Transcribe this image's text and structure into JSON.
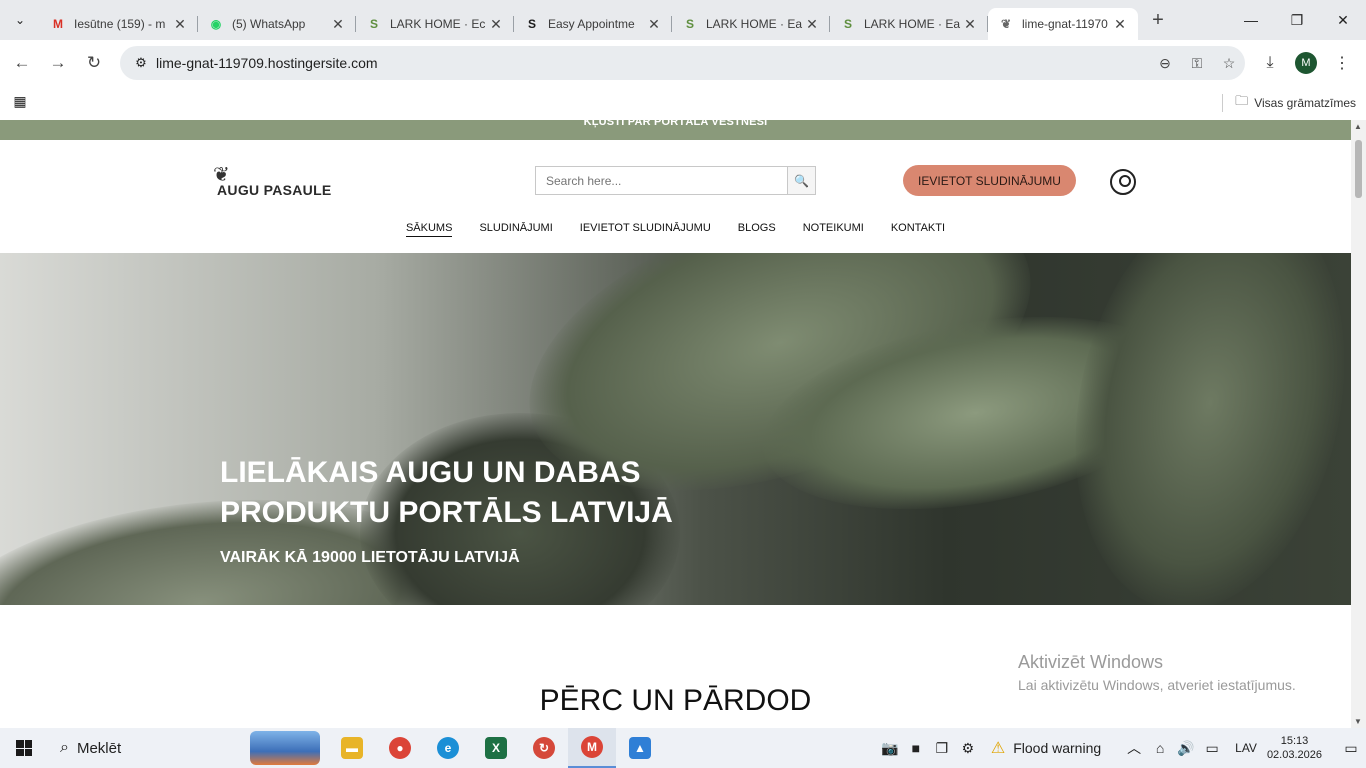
{
  "tabs": [
    {
      "title": "Iesūtne (159) - m",
      "icon": "gmail-icon",
      "glyph": "M",
      "color": "#d93025"
    },
    {
      "title": "(5) WhatsApp",
      "icon": "whatsapp-icon",
      "glyph": "◉",
      "color": "#25d366"
    },
    {
      "title": "LARK HOME · Ec",
      "icon": "shopify-icon",
      "glyph": "S",
      "color": "#5e8e3e"
    },
    {
      "title": "Easy Appointme",
      "icon": "shopify-icon",
      "glyph": "S",
      "color": "#1a1a1a"
    },
    {
      "title": "LARK HOME · Ea",
      "icon": "shopify-icon",
      "glyph": "S",
      "color": "#5e8e3e"
    },
    {
      "title": "LARK HOME · Ea",
      "icon": "shopify-icon",
      "glyph": "S",
      "color": "#5e8e3e"
    },
    {
      "title": "lime-gnat-11970",
      "icon": "leaf-icon",
      "glyph": "❦",
      "color": "#666666",
      "active": true
    }
  ],
  "address_bar": {
    "url": "lime-gnat-119709.hostingersite.com"
  },
  "profile_initial": "M",
  "bookmarks": {
    "all_bookmarks": "Visas grāmatzīmes"
  },
  "site": {
    "top_strip": "KĻŪSTI PAR PORTĀLA VĒSTNESI",
    "logo_text": "AUGU PASAULE",
    "search_placeholder": "Search here...",
    "cta": "IEVIETOT SLUDINĀJUMU",
    "nav": [
      {
        "label": "SĀKUMS",
        "active": true
      },
      {
        "label": "SLUDINĀJUMI"
      },
      {
        "label": "IEVIETOT SLUDINĀJUMU"
      },
      {
        "label": "BLOGS"
      },
      {
        "label": "NOTEIKUMI"
      },
      {
        "label": "KONTAKTI"
      }
    ],
    "hero_title": "LIELĀKAIS AUGU UN DABAS PRODUKTU PORTĀLS LATVIJĀ",
    "hero_subtitle": "VAIRĀK KĀ 19000 LIETOTĀJU LATVIJĀ",
    "section_title": "PĒRC UN PĀRDOD"
  },
  "watermark": {
    "title": "Aktivizēt Windows",
    "text": "Lai aktivizētu Windows, atveriet iestatījumus."
  },
  "taskbar": {
    "search": "Meklēt",
    "flood_warning": "Flood warning",
    "language": "LAV",
    "time": "15:13",
    "date": "02.03.2026"
  },
  "colors": {
    "accent_cta": "#d98770",
    "top_strip": "#8a9a7b"
  }
}
